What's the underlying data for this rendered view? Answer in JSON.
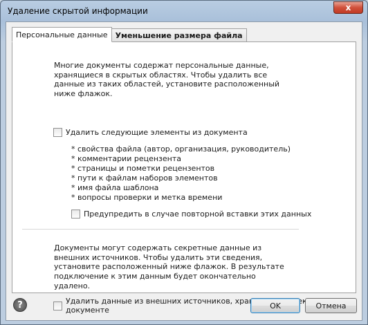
{
  "window": {
    "title": "Удаление скрытой информации",
    "close_glyph": "x"
  },
  "tabs": [
    {
      "label": "Персональные данные",
      "active": true
    },
    {
      "label": "Уменьшение размера файла",
      "active": false
    }
  ],
  "personal": {
    "intro_lines": [
      "Многие документы содержат персональные данные,",
      "хранящиеся в скрытых областях. Чтобы удалить все",
      "данные из таких областей, установите расположенный",
      "ниже флажок."
    ],
    "remove_checkbox_label": "Удалить следующие элементы из документа",
    "remove_checked": false,
    "items": [
      "* свойства файла (автор, организация, руководитель)",
      "* комментарии рецензента",
      "* страницы и пометки рецензентов",
      "* пути к файлам наборов элементов",
      "* имя файла шаблона",
      "* вопросы проверки и метка времени"
    ],
    "warn_checkbox_label": "Предупредить в случае повторной вставки этих данных",
    "warn_checked": false
  },
  "external": {
    "intro_lines": [
      "Документы могут содержать секретные данные из",
      "внешних источников. Чтобы удалить эти сведения,",
      "установите расположенный ниже флажок. В результате",
      "подключение к этим данным будет окончательно",
      "удалено."
    ],
    "checkbox_label": "Удалить данные из внешних источников, хранящихся в текущем документе",
    "checked": false
  },
  "footer": {
    "help_glyph": "?",
    "ok_label": "OK",
    "cancel_label": "Отмена"
  }
}
